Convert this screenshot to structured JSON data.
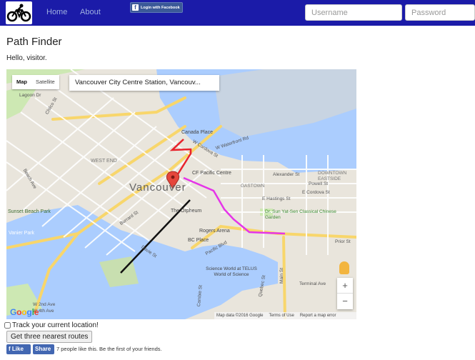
{
  "nav": {
    "logo_icon": "bicycle-icon",
    "home": "Home",
    "about": "About",
    "facebook_login": "Login with Facebook",
    "username_placeholder": "Username",
    "password_placeholder": "Password",
    "bar_color": "#1b1ba8"
  },
  "page": {
    "title": "Path Finder",
    "greeting": "Hello, visitor."
  },
  "map": {
    "type_map": "Map",
    "type_satellite": "Satellite",
    "search_value": "Vancouver City Centre Station, Vancouv...",
    "zoom_in": "+",
    "zoom_out": "−",
    "google": "Google",
    "attribution": [
      "Map data ©2016 Google",
      "Terms of Use",
      "Report a map error"
    ],
    "labels": {
      "city": "Vancouver",
      "west_end": "WEST END",
      "downtown_eastside": "DOWNTOWN EASTSIDE",
      "gastown": "GASTOWN",
      "canada_place": "Canada Place",
      "cf_pacific": "CF Pacific Centre",
      "orpheum": "The Orpheum",
      "rogers": "Rogers Arena",
      "bc_place": "BC Place",
      "science_world": "Science World at TELUS World of Science",
      "sun_yat_sen": "Dr. Sun Yat-Sen Classical Chinese Garden",
      "sunset_beach": "Sunset Beach Park",
      "vanier": "Vanier Park",
      "alexander": "Alexander St",
      "powell": "Powell St",
      "cordova": "E Cordova St",
      "hastings": "E Hastings St",
      "prior": "Prior St",
      "terminal": "Terminal Ave",
      "main": "Main St",
      "pacific": "Pacific Blvd",
      "burrard": "Burrard St",
      "davie": "Davie St",
      "beach_ave": "Beach Ave",
      "w_cordova": "W Cordova St",
      "w_waterfront": "W Waterfront Rd",
      "lagoon": "Lagoon Dr",
      "chilco": "Chilco St",
      "w_2nd": "W 2nd Ave",
      "w_4th": "W 4th Ave",
      "quebec": "Quebec St",
      "cambie": "Cambie St"
    },
    "route_colors": {
      "route_1": "#e8232c",
      "route_2": "#e535e8",
      "route_3": "#111111"
    }
  },
  "controls": {
    "track_label": "Track your current location!",
    "routes_button": "Get three nearest routes",
    "fb_like": "Like",
    "fb_share": "Share",
    "fb_text": "7 people like this. Be the first of your friends."
  }
}
